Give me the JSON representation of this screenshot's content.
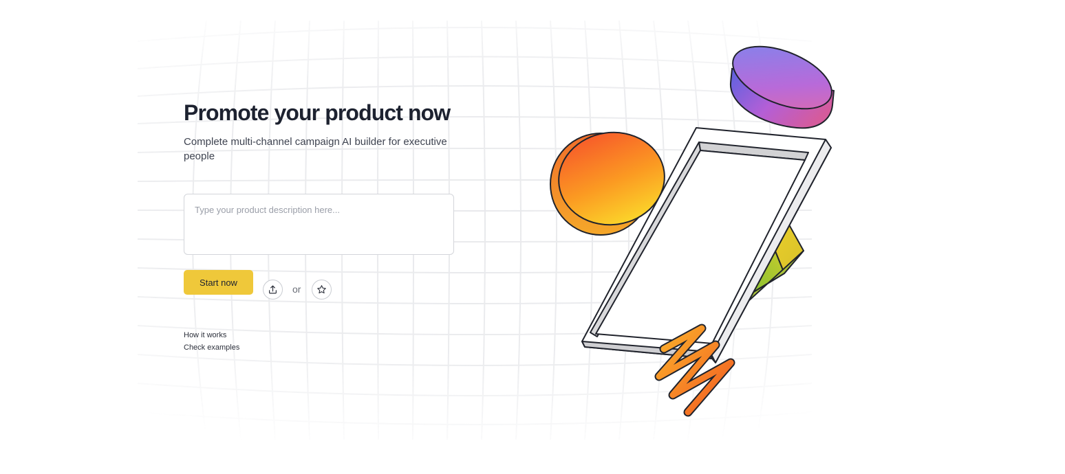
{
  "hero": {
    "title": "Promote your product now",
    "subtitle": "Complete multi-channel campaign AI builder for executive people"
  },
  "input": {
    "placeholder": "Type your product description here...",
    "value": ""
  },
  "actions": {
    "start_label": "Start now",
    "separator": "or",
    "upload_icon": "upload-icon",
    "star_icon": "star-icon"
  },
  "links": {
    "how_it_works": "How it works",
    "check_examples": "Check examples"
  },
  "colors": {
    "accent": "#efc83a",
    "title": "#1d2230"
  }
}
